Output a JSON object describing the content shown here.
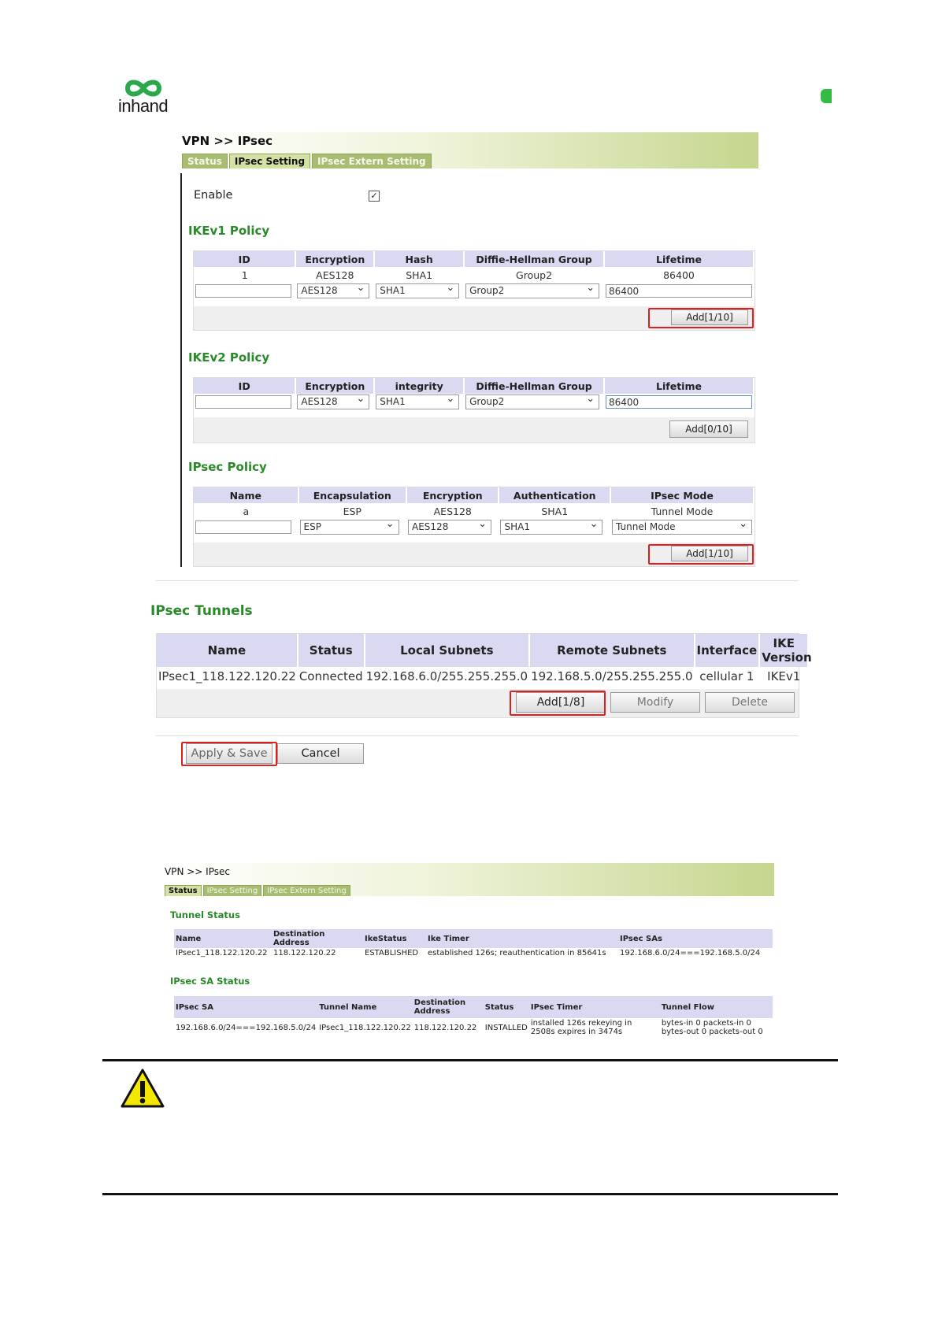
{
  "logo": {
    "text": "inhand"
  },
  "panel1": {
    "breadcrumb": "VPN >> IPsec",
    "tabs": [
      "Status",
      "IPsec Setting",
      "IPsec Extern Setting"
    ],
    "enable_label": "Enable",
    "enable_checked": true,
    "ikev1": {
      "title": "IKEv1 Policy",
      "headers": [
        "ID",
        "Encryption",
        "Hash",
        "Diffie-Hellman Group",
        "Lifetime"
      ],
      "row": [
        "1",
        "AES128",
        "SHA1",
        "Group2",
        "86400"
      ],
      "form": {
        "id": "",
        "encryption": "AES128",
        "hash": "SHA1",
        "dh": "Group2",
        "lifetime": "86400"
      },
      "add_label": "Add[1/10]"
    },
    "ikev2": {
      "title": "IKEv2 Policy",
      "headers": [
        "ID",
        "Encryption",
        "integrity",
        "Diffie-Hellman Group",
        "Lifetime"
      ],
      "form": {
        "id": "",
        "encryption": "AES128",
        "integrity": "SHA1",
        "dh": "Group2",
        "lifetime": "86400"
      },
      "add_label": "Add[0/10]"
    },
    "ipsec": {
      "title": "IPsec Policy",
      "headers": [
        "Name",
        "Encapsulation",
        "Encryption",
        "Authentication",
        "IPsec Mode"
      ],
      "row": [
        "a",
        "ESP",
        "AES128",
        "SHA1",
        "Tunnel Mode"
      ],
      "form": {
        "name": "",
        "encapsulation": "ESP",
        "encryption": "AES128",
        "authentication": "SHA1",
        "mode": "Tunnel Mode"
      },
      "add_label": "Add[1/10]"
    }
  },
  "tunnels": {
    "title": "IPsec Tunnels",
    "headers": [
      "Name",
      "Status",
      "Local Subnets",
      "Remote Subnets",
      "Interface",
      "IKE Version"
    ],
    "row": [
      "IPsec1_118.122.120.22",
      "Connected",
      "192.168.6.0/255.255.255.0",
      "192.168.5.0/255.255.255.0",
      "cellular 1",
      "IKEv1"
    ],
    "add_label": "Add[1/8]",
    "modify_label": "Modify",
    "delete_label": "Delete"
  },
  "actions": {
    "apply_label": "Apply & Save",
    "cancel_label": "Cancel"
  },
  "panel2": {
    "breadcrumb": "VPN >> IPsec",
    "tabs": [
      "Status",
      "IPsec Setting",
      "IPsec Extern Setting"
    ],
    "tunnel_status": {
      "title": "Tunnel Status",
      "headers": [
        "Name",
        "Destination Address",
        "IkeStatus",
        "Ike Timer",
        "IPsec SAs"
      ],
      "row": [
        "IPsec1_118.122.120.22",
        "118.122.120.22",
        "ESTABLISHED",
        "established 126s; reauthentication in 85641s",
        "192.168.6.0/24===192.168.5.0/24"
      ]
    },
    "sa_status": {
      "title": "IPsec SA Status",
      "headers": [
        "IPsec SA",
        "Tunnel Name",
        "Destination Address",
        "Status",
        "IPsec Timer",
        "Tunnel Flow"
      ],
      "row": [
        "192.168.6.0/24===192.168.5.0/24",
        "IPsec1_118.122.120.22",
        "118.122.120.22",
        "INSTALLED",
        "installed 126s rekeying in 2508s expires in 3474s",
        "bytes-in 0 packets-in 0 bytes-out 0 packets-out 0"
      ]
    }
  },
  "colors": {
    "section_title": "#2a8a2a",
    "header_bg": "#d9d9f2",
    "highlight": "#e02020",
    "tab_active": "#d4e1a5"
  }
}
